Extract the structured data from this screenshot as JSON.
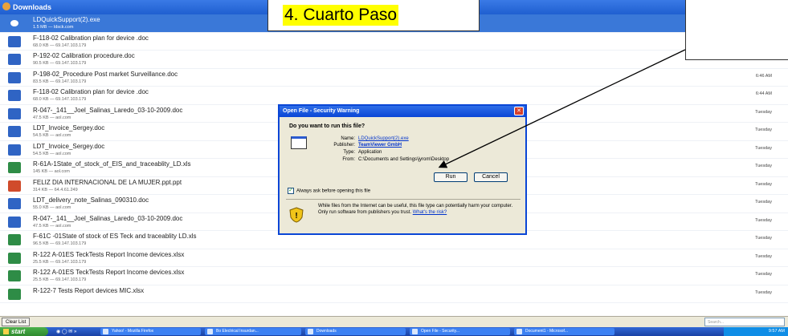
{
  "window": {
    "title": "Downloads"
  },
  "downloads": [
    {
      "name": "LDQuickSupport(2).exe",
      "meta": "1.5 MB — ldsck.com",
      "time": "",
      "type": "exe",
      "selected": true
    },
    {
      "name": "F-118-02 Calibration plan for device .doc",
      "meta": "68.0 KB — 69.147.103.179",
      "time": "",
      "type": "doc"
    },
    {
      "name": "P-192-02 Calibration procedure.doc",
      "meta": "90.5 KB — 69.147.103.179",
      "time": "",
      "type": "doc"
    },
    {
      "name": "P-198-02_Procedure Post market Surveillance.doc",
      "meta": "83.5 KB — 69.147.103.179",
      "time": "6:46 AM",
      "type": "doc"
    },
    {
      "name": "F-118-02 Calibration plan for device .doc",
      "meta": "68.0 KB — 69.147.103.179",
      "time": "6:44 AM",
      "type": "doc"
    },
    {
      "name": "R-047-_141__Joel_Salinas_Laredo_03-10-2009.doc",
      "meta": "47.5 KB — aol.com",
      "time": "Tuesday",
      "type": "doc"
    },
    {
      "name": "LDT_Invoice_Sergey.doc",
      "meta": "54.5 KB — aol.com",
      "time": "Tuesday",
      "type": "doc"
    },
    {
      "name": "LDT_Invoice_Sergey.doc",
      "meta": "54.5 KB — aol.com",
      "time": "Tuesday",
      "type": "doc"
    },
    {
      "name": "R-61A-1State_of_stock_of_EIS_and_traceablity_LD.xls",
      "meta": "145 KB — aol.com",
      "time": "Tuesday",
      "type": "xls"
    },
    {
      "name": "FELIZ DIA INTERNACIONAL DE LA MUJER.ppt.ppt",
      "meta": "314 KB — 64.4.61.249",
      "time": "Tuesday",
      "type": "ppt"
    },
    {
      "name": "LDT_delivery_note_Salinas_090310.doc",
      "meta": "55.0 KB — aol.com",
      "time": "Tuesday",
      "type": "doc"
    },
    {
      "name": "R-047-_141__Joel_Salinas_Laredo_03-10-2009.doc",
      "meta": "47.5 KB — aol.com",
      "time": "Tuesday",
      "type": "doc"
    },
    {
      "name": "F-61C -01State of stock of ES Teck and traceablity LD.xls",
      "meta": "96.5 KB — 69.147.103.179",
      "time": "Tuesday",
      "type": "xls"
    },
    {
      "name": "R-122 A-01ES TeckTests Report Income devices.xlsx",
      "meta": "25.5 KB — 69.147.103.179",
      "time": "Tuesday",
      "type": "xls"
    },
    {
      "name": "R-122 A-01ES TeckTests Report Income devices.xlsx",
      "meta": "25.5 KB — 69.147.103.179",
      "time": "Tuesday",
      "type": "xls"
    },
    {
      "name": "R-122-7 Tests Report devices MIC.xlsx",
      "meta": "",
      "time": "Tuesday",
      "type": "xls"
    }
  ],
  "bottom": {
    "clear_label": "Clear List",
    "search_placeholder": "Search..."
  },
  "dialog": {
    "title": "Open File - Security Warning",
    "close_glyph": "✕",
    "question": "Do you want to run this file?",
    "name_label": "Name:",
    "name_value": "LDQuickSupport(2).exe",
    "publisher_label": "Publisher:",
    "publisher_value": "TeamViewer GmbH",
    "type_label": "Type:",
    "type_value": "Application",
    "from_label": "From:",
    "from_value": "C:\\Documents and Settings\\jyrom\\Desktop",
    "run_label": "Run",
    "cancel_label": "Cancel",
    "checkbox_label": "Always ask before opening this file",
    "checkbox_checked": true,
    "warning_text": "While files from the Internet can be useful, this file type can potentially harm your computer. Only run software from publishers you trust.",
    "warning_link": "What's the risk?"
  },
  "annotation": {
    "text": "4. Cuarto Paso",
    "highlight_color": "#ffff00"
  },
  "taskbar": {
    "start_label": "start",
    "quick_launch": "◉ ◯ ✉ »",
    "items": [
      "Yahoo! - Mozilla Firefox",
      "Bo Electrical Insurdan...",
      "Downloads",
      "Open File - Security...",
      "Document1 - Microsof..."
    ],
    "tray_time": "9:57 AM"
  },
  "colors": {
    "xp_blue": "#0a46d6",
    "selected_row": "#3a78d8",
    "dialog_bg": "#ece9d8"
  }
}
